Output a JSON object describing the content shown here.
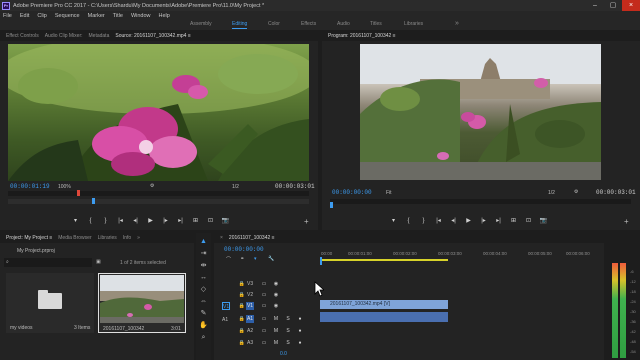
{
  "titlebar": {
    "logo_text": "Pr",
    "title": "Adobe Premiere Pro CC 2017 - C:\\Users\\Shardu\\My Documents\\Adobe\\Premiere Pro\\11.0\\My Project *"
  },
  "menu": [
    "File",
    "Edit",
    "Clip",
    "Sequence",
    "Marker",
    "Title",
    "Window",
    "Help"
  ],
  "workspaces": {
    "tabs": [
      "Assembly",
      "Editing",
      "Color",
      "Effects",
      "Audio",
      "Titles",
      "Libraries"
    ],
    "active": "Editing",
    "more": "»"
  },
  "source_panel": {
    "tabs": [
      "Effect Controls",
      "Audio Clip Mixer:",
      "Metadata",
      "Source: 20161107_100342.mp4 ≡"
    ],
    "current_timecode": "00:00:01:19",
    "zoom": "100%",
    "fraction": "1/2",
    "duration": "00:00:03:01",
    "controls": [
      "▾",
      "{",
      "}",
      "|◂",
      "◂|",
      "▶",
      "|▸",
      "▸|",
      "⊞",
      "⊡",
      "📷",
      "+"
    ]
  },
  "program_panel": {
    "tab": "Program: 20161107_100342 ≡",
    "current_timecode": "00:00:00:00",
    "fit": "Fit",
    "fraction": "1/2",
    "duration": "00:00:03:01",
    "controls": [
      "▾",
      "{",
      "}",
      "|◂",
      "◂|",
      "▶",
      "|▸",
      "▸|",
      "⊞",
      "⊡",
      "📷",
      "+"
    ]
  },
  "project_panel": {
    "tabs": [
      "Project: My Project ≡",
      "Media Browser",
      "Libraries",
      "Info",
      "»"
    ],
    "file": "My Project.prproj",
    "selection": "1 of 2 items selected",
    "items": [
      {
        "name": "my videos",
        "meta": "3 Items"
      },
      {
        "name": "20161107_100342",
        "meta": "3:01"
      }
    ]
  },
  "timeline": {
    "tab": "20161107_100342 ≡",
    "timecode": "00:00:00:00",
    "ruler": [
      "00:00",
      "00:00:01:00",
      "00:00:02:00",
      "00:00:03:00",
      "00:00:04:00",
      "00:00:05:00",
      "00:00:06:00"
    ],
    "video_tracks": [
      {
        "name": "V3",
        "target": ""
      },
      {
        "name": "V2",
        "target": ""
      },
      {
        "name": "V1",
        "target": "V1"
      }
    ],
    "audio_tracks": [
      {
        "name": "A1",
        "target": "A1",
        "m": "M",
        "s": "S"
      },
      {
        "name": "A2",
        "target": "",
        "m": "M",
        "s": "S"
      },
      {
        "name": "A3",
        "target": "",
        "m": "M",
        "s": "S"
      }
    ],
    "audio_master": "0.0",
    "clip_label": "20161107_100342.mp4 [V]"
  },
  "meter": {
    "labels": [
      "-6",
      "-12",
      "-18",
      "-24",
      "-30",
      "-36",
      "-42",
      "-48",
      "-54"
    ],
    "unit": "dB"
  }
}
